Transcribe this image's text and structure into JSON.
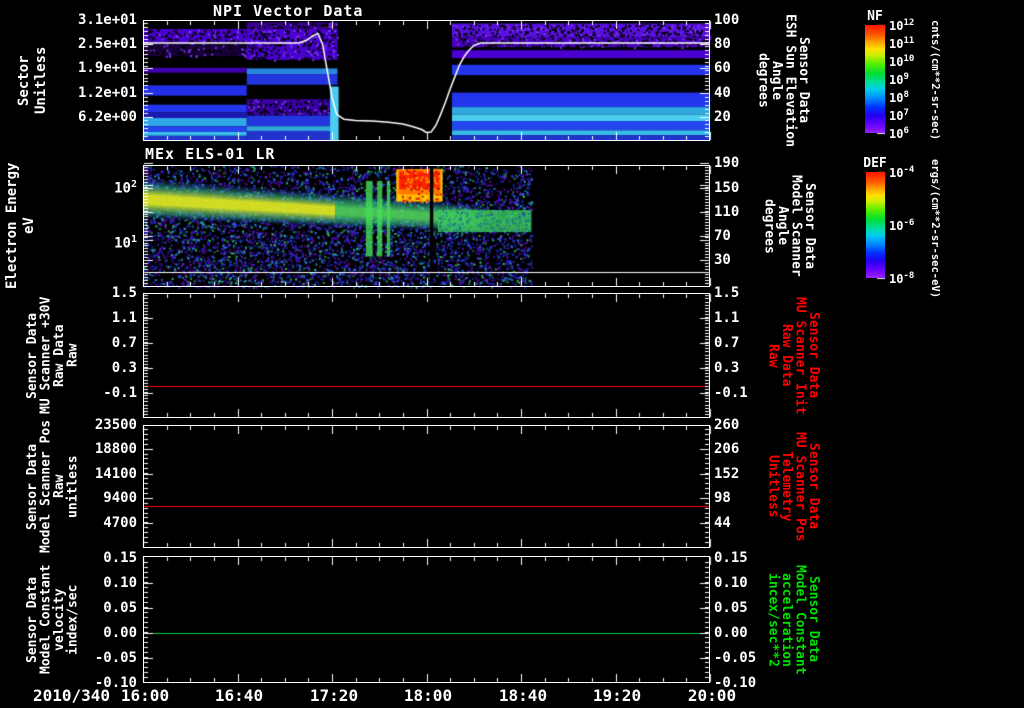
{
  "xaxis": {
    "date": "2010/340",
    "tick_labels": [
      "16:00",
      "16:40",
      "17:20",
      "18:00",
      "18:40",
      "19:20",
      "20:00"
    ],
    "range_minutes": [
      0,
      240
    ],
    "minor_step_minutes": 10,
    "major_step_minutes": 40
  },
  "chart_data": [
    {
      "type": "heatmap",
      "title": "NPI Vector Data",
      "left_axis": {
        "label_lines": [
          "Sector",
          "Unitless"
        ],
        "ticks": [
          "3.1e+01",
          "2.5e+01",
          "1.9e+01",
          "1.2e+01",
          "6.2e+00"
        ],
        "range": [
          0,
          31
        ]
      },
      "right_axis": {
        "label_lines": [
          "Sensor Data",
          "ESH Sun Elevation",
          "Angle",
          "degrees"
        ],
        "ticks": [
          "100",
          "80",
          "60",
          "40",
          "20"
        ],
        "range": [
          0,
          100
        ]
      },
      "colorbar": {
        "title": "NF",
        "units": "cnts/(cm**2-sr-sec)",
        "tick_base": "10",
        "tick_exps": [
          "12",
          "11",
          "10",
          "9",
          "8",
          "7",
          "6"
        ]
      },
      "overlay_line": {
        "label": "ESH Sun Elevation Angle",
        "color": "#ffffff",
        "points": [
          [
            0,
            81
          ],
          [
            66,
            81
          ],
          [
            69,
            83
          ],
          [
            72,
            87
          ],
          [
            74,
            89
          ],
          [
            76,
            80
          ],
          [
            78,
            58
          ],
          [
            80,
            36
          ],
          [
            82,
            22
          ],
          [
            85,
            18
          ],
          [
            90,
            17
          ],
          [
            97,
            16.5
          ],
          [
            104,
            15.5
          ],
          [
            110,
            14
          ],
          [
            114,
            12
          ],
          [
            118,
            9.5
          ],
          [
            120,
            7
          ],
          [
            122,
            7.5
          ],
          [
            124,
            13
          ],
          [
            126,
            22
          ],
          [
            128,
            32
          ],
          [
            130,
            43
          ],
          [
            132,
            53
          ],
          [
            134,
            63
          ],
          [
            136,
            70
          ],
          [
            138,
            75
          ],
          [
            140,
            79
          ],
          [
            143,
            81
          ],
          [
            240,
            81
          ]
        ]
      },
      "data_gap_frac": [
        0.343,
        0.545
      ],
      "segments": [
        {
          "x0": 0,
          "x1": 0.183,
          "bands": [
            [
              0.075,
              0.185,
              "#4a00d0",
              1
            ],
            [
              0.185,
              0.3,
              "#1a0040",
              1
            ],
            [
              0.395,
              0.435,
              "#4000b0",
              0
            ],
            [
              0.54,
              0.625,
              "#2130e8",
              0
            ],
            [
              0.7,
              0.765,
              "#2336ee",
              0
            ],
            [
              0.765,
              0.81,
              "#1a1ab0",
              0
            ],
            [
              0.81,
              0.878,
              "#2fa8e8",
              0
            ],
            [
              0.878,
              0.925,
              "#2446ee",
              0
            ],
            [
              0.925,
              0.957,
              "#37bcec",
              0
            ],
            [
              0.957,
              1,
              "#2336cc",
              0
            ]
          ]
        },
        {
          "x0": 0.183,
          "x1": 0.343,
          "bands": [
            [
              0.02,
              0.075,
              "#3a0090",
              1
            ],
            [
              0.075,
              0.33,
              "#4a00d0",
              1
            ],
            [
              0.4,
              0.447,
              "#2b86dd",
              0
            ],
            [
              0.447,
              0.535,
              "#2236dd",
              0
            ],
            [
              0.655,
              0.79,
              "#3c00a8",
              1
            ],
            [
              0.79,
              0.878,
              "#2236dd",
              0
            ],
            [
              0.878,
              0.917,
              "#2fa8dd",
              0
            ],
            [
              0.917,
              1,
              "#2234cc",
              0
            ]
          ]
        },
        {
          "x0": 0.545,
          "x1": 1,
          "bands": [
            [
              0.03,
              0.145,
              "#5a10e0",
              1
            ],
            [
              0.145,
              0.225,
              "#4a00c0",
              1
            ],
            [
              0.25,
              0.315,
              "#4a00d0",
              0
            ],
            [
              0.37,
              0.455,
              "#2336ee",
              0
            ],
            [
              0.6,
              0.72,
              "#2336ee",
              0
            ],
            [
              0.72,
              0.78,
              "#2fa8e0",
              0
            ],
            [
              0.78,
              0.835,
              "#49cdf0",
              0
            ],
            [
              0.835,
              0.912,
              "#2446ee",
              0
            ],
            [
              0.912,
              0.952,
              "#37bcec",
              0
            ],
            [
              0.952,
              1,
              "#2336cc",
              0
            ]
          ]
        }
      ],
      "cyan_column": {
        "x0": 0.33,
        "x1": 0.345,
        "y0": 0.55,
        "y1": 1,
        "color": "#49cdf0"
      }
    },
    {
      "type": "heatmap",
      "title": "MEx ELS-01 LR",
      "left_axis": {
        "label_lines": [
          "Electron Energy",
          "eV"
        ],
        "tick_base": "10",
        "tick_exps": [
          "2",
          "1"
        ]
      },
      "right_axis": {
        "label_lines": [
          "Sensor Data",
          "Model Scanner",
          "Angle",
          "degrees"
        ],
        "ticks": [
          "190",
          "150",
          "110",
          "70",
          "30"
        ]
      },
      "colorbar": {
        "title": "DEF",
        "units": "ergs/(cm**2-sr-sec-eV)",
        "tick_base": "10",
        "tick_exps": [
          "-4",
          "-6",
          "-8"
        ]
      },
      "features": {
        "noise_x1": 0.685,
        "noise_count": 5200,
        "noise_colors": [
          "#2222cc",
          "#3344ee",
          "#5511bb",
          "#2299dd",
          "#33cc66",
          "#7700cc"
        ],
        "energy_band": {
          "x0": 0,
          "x1": 0.615,
          "top0": 0.1,
          "bot0": 0.45,
          "top1": 0.33,
          "bot1": 0.56,
          "core_left": "rgba(220,230,35,0.95)",
          "core_right": "rgba(80,210,90,0.9)",
          "edge": "rgba(50,180,140,0.55)",
          "yellow_until": 0.55
        },
        "hot_blob": {
          "x0": 0.452,
          "x1": 0.523,
          "y0": 0.035,
          "y1": 0.3,
          "core": "#ff2200",
          "mid": "#ff7700",
          "fringe": "#ffc400"
        },
        "mid_band": {
          "x0": 0.52,
          "x1": 0.685,
          "y0": 0.37,
          "y1": 0.55,
          "color": "rgba(60,205,90,0.85)"
        },
        "green_columns": [
          {
            "x": 0.393,
            "w": 0.012
          },
          {
            "x": 0.413,
            "w": 0.009
          },
          {
            "x": 0.43,
            "w": 0.006
          }
        ],
        "dropout_column": {
          "x": 0.506,
          "w": 0.006
        },
        "baseline_y_frac": 0.877
      }
    },
    {
      "type": "line",
      "left_axis": {
        "label_lines": [
          "Sensor Data",
          "MU Scanner +30V",
          "Raw Data",
          "Raw"
        ],
        "ticks": [
          "1.5",
          "1.1",
          "0.7",
          "0.3",
          "-0.1"
        ],
        "range": [
          -0.5,
          1.5
        ]
      },
      "right_axis": {
        "label_lines": [
          "Sensor Data",
          "MU Scanner Init",
          "Raw Data",
          "Raw"
        ],
        "ticks": [
          "1.5",
          "1.1",
          "0.7",
          "0.3",
          "-0.1"
        ],
        "color": "#ff0000"
      },
      "series": [
        {
          "name": "MU Scanner +30V Raw",
          "color": "#ff0000",
          "value": 0
        }
      ]
    },
    {
      "type": "line",
      "left_axis": {
        "label_lines": [
          "Sensor Data",
          "Model Scanner Pos",
          "Raw",
          "unitless"
        ],
        "ticks": [
          "23500",
          "18800",
          "14100",
          "9400",
          "4700"
        ],
        "range": [
          0,
          23500
        ]
      },
      "right_axis": {
        "label_lines": [
          "Sensor Data",
          "MU Scanner Pos",
          "Telemetry",
          "Unitless"
        ],
        "ticks": [
          "260",
          "206",
          "152",
          "98",
          "44"
        ],
        "color": "#ff0000"
      },
      "series": [
        {
          "name": "Model Scanner Pos Raw",
          "color": "#ff0000",
          "value": 8000
        }
      ]
    },
    {
      "type": "line",
      "left_axis": {
        "label_lines": [
          "Sensor Data",
          "Model Constant",
          "velocity",
          "index/sec"
        ],
        "ticks": [
          "0.15",
          "0.10",
          "0.05",
          "0.00",
          "-0.05",
          "-0.10"
        ],
        "range": [
          -0.1,
          0.155
        ]
      },
      "right_axis": {
        "label_lines": [
          "Sensor Data",
          "Model Constant",
          "acceleration",
          "incex/sec**2"
        ],
        "ticks": [
          "0.15",
          "0.10",
          "0.05",
          "0.00",
          "-0.05",
          "-0.10"
        ],
        "color": "#00e000"
      },
      "series": [
        {
          "name": "Model Constant velocity",
          "color": "#00cc44",
          "value": 0
        }
      ]
    }
  ]
}
